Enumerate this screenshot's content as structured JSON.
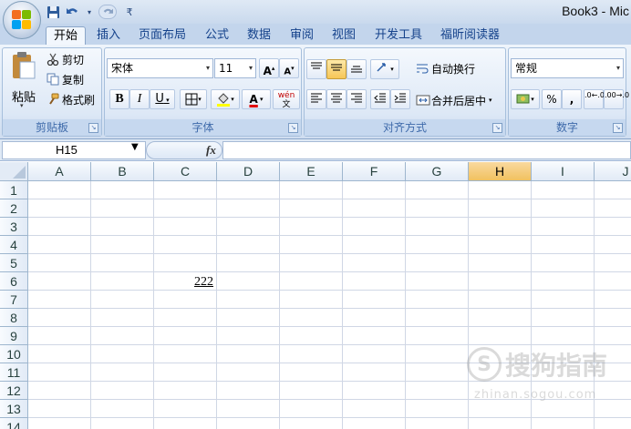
{
  "window": {
    "title": "Book3 - Mic"
  },
  "qat": {
    "save_icon": "save-icon",
    "undo_icon": "undo-icon",
    "redo_icon": "redo-icon"
  },
  "tabs": [
    {
      "label": "开始",
      "active": true
    },
    {
      "label": "插入"
    },
    {
      "label": "页面布局"
    },
    {
      "label": "公式"
    },
    {
      "label": "数据"
    },
    {
      "label": "审阅"
    },
    {
      "label": "视图"
    },
    {
      "label": "开发工具"
    },
    {
      "label": "福昕阅读器"
    }
  ],
  "clipboard": {
    "paste": "粘贴",
    "cut": "剪切",
    "copy": "复制",
    "format_painter": "格式刷",
    "group": "剪贴板"
  },
  "font": {
    "name": "宋体",
    "size": "11",
    "bold": "B",
    "italic": "I",
    "underline": "U",
    "grow": "A",
    "shrink": "A",
    "font_color_glyph": "A",
    "phonetic": "wén",
    "group": "字体"
  },
  "alignment": {
    "wrap": "自动换行",
    "merge": "合并后居中",
    "group": "对齐方式"
  },
  "number": {
    "format": "常规",
    "percent": "%",
    "comma": ",",
    "inc": ".0←.00",
    "dec": ".00→.0",
    "group": "数字"
  },
  "formula_bar": {
    "name_box": "H15",
    "fx": "fx",
    "value": ""
  },
  "columns": [
    "A",
    "B",
    "C",
    "D",
    "E",
    "F",
    "G",
    "H",
    "I",
    "J"
  ],
  "selected_column": "H",
  "rows": [
    "1",
    "2",
    "3",
    "4",
    "5",
    "6",
    "7",
    "8",
    "9",
    "10",
    "11",
    "12",
    "13",
    "14"
  ],
  "cells": {
    "C6": "222"
  },
  "watermark": {
    "brand": "搜狗指南",
    "url": "zhinan.sogou.com"
  },
  "colors": {
    "accent": "#15428b",
    "selected_header": "#f1c15f",
    "ribbon": "#dbe7f6"
  }
}
